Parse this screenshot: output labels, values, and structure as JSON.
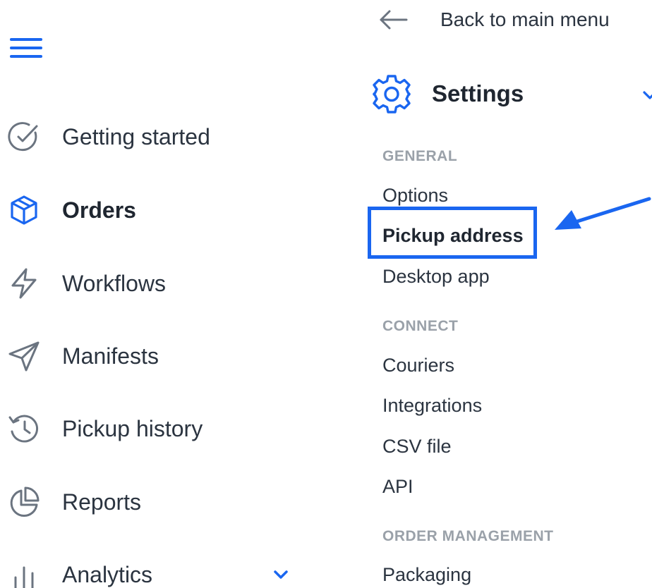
{
  "sidebar": {
    "items": [
      {
        "label": "Getting started",
        "icon": "check-circle-icon",
        "active": false
      },
      {
        "label": "Orders",
        "icon": "box-icon",
        "active": true
      },
      {
        "label": "Workflows",
        "icon": "lightning-icon",
        "active": false
      },
      {
        "label": "Manifests",
        "icon": "send-icon",
        "active": false
      },
      {
        "label": "Pickup history",
        "icon": "history-icon",
        "active": false
      },
      {
        "label": "Reports",
        "icon": "pie-chart-icon",
        "active": false
      },
      {
        "label": "Analytics",
        "icon": "bar-chart-icon",
        "active": false,
        "expandable": true
      }
    ]
  },
  "panel": {
    "back_label": "Back to main menu",
    "settings_title": "Settings",
    "sections": [
      {
        "title": "GENERAL",
        "links": [
          "Options",
          "Pickup address",
          "Desktop app"
        ]
      },
      {
        "title": "CONNECT",
        "links": [
          "Couriers",
          "Integrations",
          "CSV file",
          "API"
        ]
      },
      {
        "title": "ORDER MANAGEMENT",
        "links": [
          "Packaging"
        ]
      }
    ],
    "selected_link": "Pickup address"
  },
  "colors": {
    "accent": "#1a66f0",
    "text": "#2b3440",
    "muted": "#9aa1a9",
    "icon_gray": "#6b7480"
  }
}
